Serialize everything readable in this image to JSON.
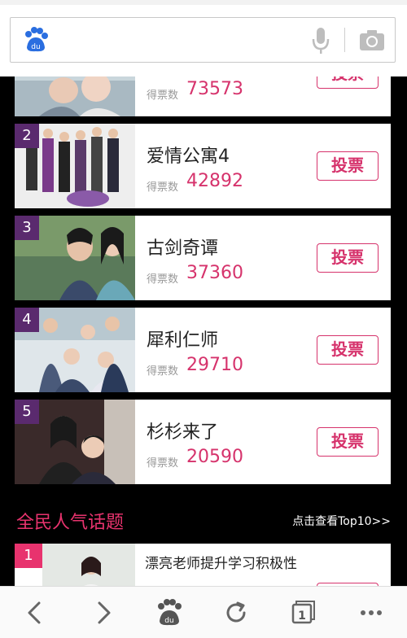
{
  "search": {
    "placeholder": ""
  },
  "colors": {
    "accent": "#d6336c",
    "rank_bg": "#5a2a6e",
    "section_title": "#e8336e",
    "background": "#000000"
  },
  "ranking": {
    "vote_label": "得票数",
    "vote_button": "投票",
    "items": [
      {
        "rank": "",
        "title": "",
        "votes": "73573"
      },
      {
        "rank": "2",
        "title": "爱情公寓4",
        "votes": "42892"
      },
      {
        "rank": "3",
        "title": "古剑奇谭",
        "votes": "37360"
      },
      {
        "rank": "4",
        "title": "犀利仁师",
        "votes": "29710"
      },
      {
        "rank": "5",
        "title": "杉杉来了",
        "votes": "20590"
      }
    ]
  },
  "topics": {
    "section_title": "全民人气话题",
    "more_link": "点击查看Top10>>",
    "items": [
      {
        "rank": "1",
        "title": "漂亮老师提升学习积极性"
      }
    ]
  },
  "bottom_nav": {
    "icons": [
      "back-icon",
      "forward-icon",
      "baidu-home-icon",
      "refresh-icon",
      "tabs-icon",
      "menu-icon"
    ],
    "tab_count": "1"
  }
}
